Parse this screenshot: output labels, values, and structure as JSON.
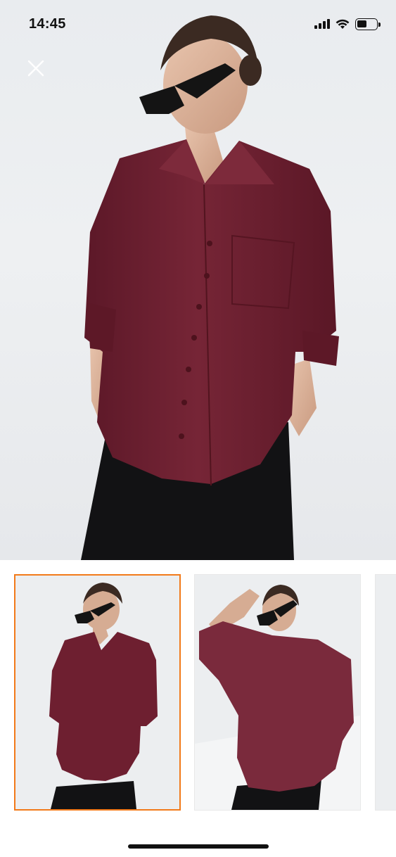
{
  "status_bar": {
    "time": "14:45",
    "icons": [
      "signal-icon",
      "wifi-icon",
      "battery-icon"
    ]
  },
  "hero": {
    "image": "product-photo-burgundy-shirt-front",
    "close_icon": "close-icon"
  },
  "gallery": {
    "thumbnails": [
      {
        "name": "thumbnail-front",
        "selected": true
      },
      {
        "name": "thumbnail-pose",
        "selected": false
      },
      {
        "name": "thumbnail-next",
        "selected": false
      }
    ]
  },
  "colors": {
    "accent": "#f27a1a",
    "shirt": "#6e1f30",
    "pants": "#121214",
    "background": "#ffffff"
  }
}
